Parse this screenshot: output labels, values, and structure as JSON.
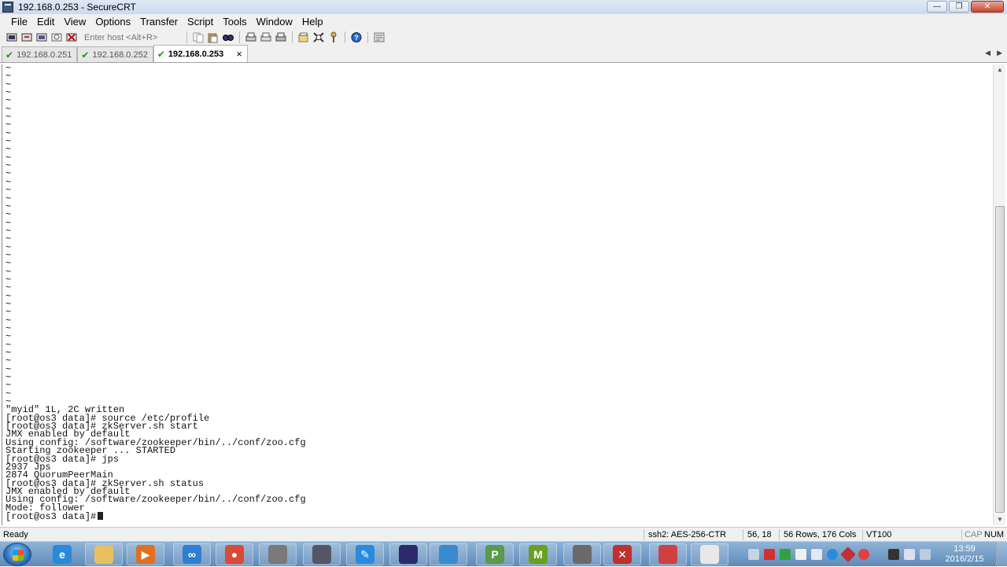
{
  "window": {
    "title": "192.168.0.253 - SecureCRT",
    "controls": {
      "minimize": "—",
      "maximize": "❐",
      "close": "✕"
    }
  },
  "menu": [
    "File",
    "Edit",
    "View",
    "Options",
    "Transfer",
    "Script",
    "Tools",
    "Window",
    "Help"
  ],
  "toolbar": {
    "host_placeholder": "Enter host <Alt+R>"
  },
  "tabs": [
    {
      "label": "192.168.0.251",
      "active": false
    },
    {
      "label": "192.168.0.252",
      "active": false
    },
    {
      "label": "192.168.0.253",
      "active": true
    }
  ],
  "tab_nav": {
    "prev": "◀",
    "next": "▶"
  },
  "terminal": {
    "tilde_line": "~",
    "tilde_count": 42,
    "lines": [
      "\"myid\" 1L, 2C written",
      "[root@os3 data]# source /etc/profile",
      "[root@os3 data]# zkServer.sh start",
      "JMX enabled by default",
      "Using config: /software/zookeeper/bin/../conf/zoo.cfg",
      "Starting zookeeper ... STARTED",
      "[root@os3 data]# jps",
      "2937 Jps",
      "2874 QuorumPeerMain",
      "[root@os3 data]# zkServer.sh status",
      "JMX enabled by default",
      "Using config: /software/zookeeper/bin/../conf/zoo.cfg",
      "Mode: follower",
      "[root@os3 data]#"
    ]
  },
  "statusbar": {
    "ready": "Ready",
    "cipher": "ssh2: AES-256-CTR",
    "cursor": "56,  18",
    "size": "56 Rows, 176 Cols",
    "emulation": "VT100",
    "caps": "CAP",
    "num": "NUM"
  },
  "taskbar": {
    "time": "13:59",
    "date": "2016/2/15",
    "apps": [
      {
        "name": "internet-explorer",
        "color": "#2a8ad8",
        "glyph": "e"
      },
      {
        "name": "file-explorer",
        "color": "#e8c060",
        "glyph": ""
      },
      {
        "name": "media-player",
        "color": "#e07020",
        "glyph": "▶"
      },
      {
        "name": "cloud-drive",
        "color": "#2f7fd0",
        "glyph": "∞"
      },
      {
        "name": "chrome",
        "color": "#d94a38",
        "glyph": "●"
      },
      {
        "name": "app-6",
        "color": "#7a7a7a",
        "glyph": ""
      },
      {
        "name": "app-7",
        "color": "#556",
        "glyph": ""
      },
      {
        "name": "feather-app",
        "color": "#2a8ae0",
        "glyph": "✎"
      },
      {
        "name": "eclipse",
        "color": "#2c2a6a",
        "glyph": ""
      },
      {
        "name": "app-10",
        "color": "#3a8ad0",
        "glyph": ""
      },
      {
        "name": "app-11",
        "color": "#5a9a4a",
        "glyph": "P"
      },
      {
        "name": "app-12",
        "color": "#6aa020",
        "glyph": "M"
      },
      {
        "name": "securecrt",
        "color": "#6a6a6a",
        "glyph": ""
      },
      {
        "name": "app-14",
        "color": "#c03030",
        "glyph": "✕"
      },
      {
        "name": "app-15",
        "color": "#d04040",
        "glyph": ""
      },
      {
        "name": "dubbo",
        "color": "#e8e8e8",
        "glyph": ""
      }
    ]
  }
}
